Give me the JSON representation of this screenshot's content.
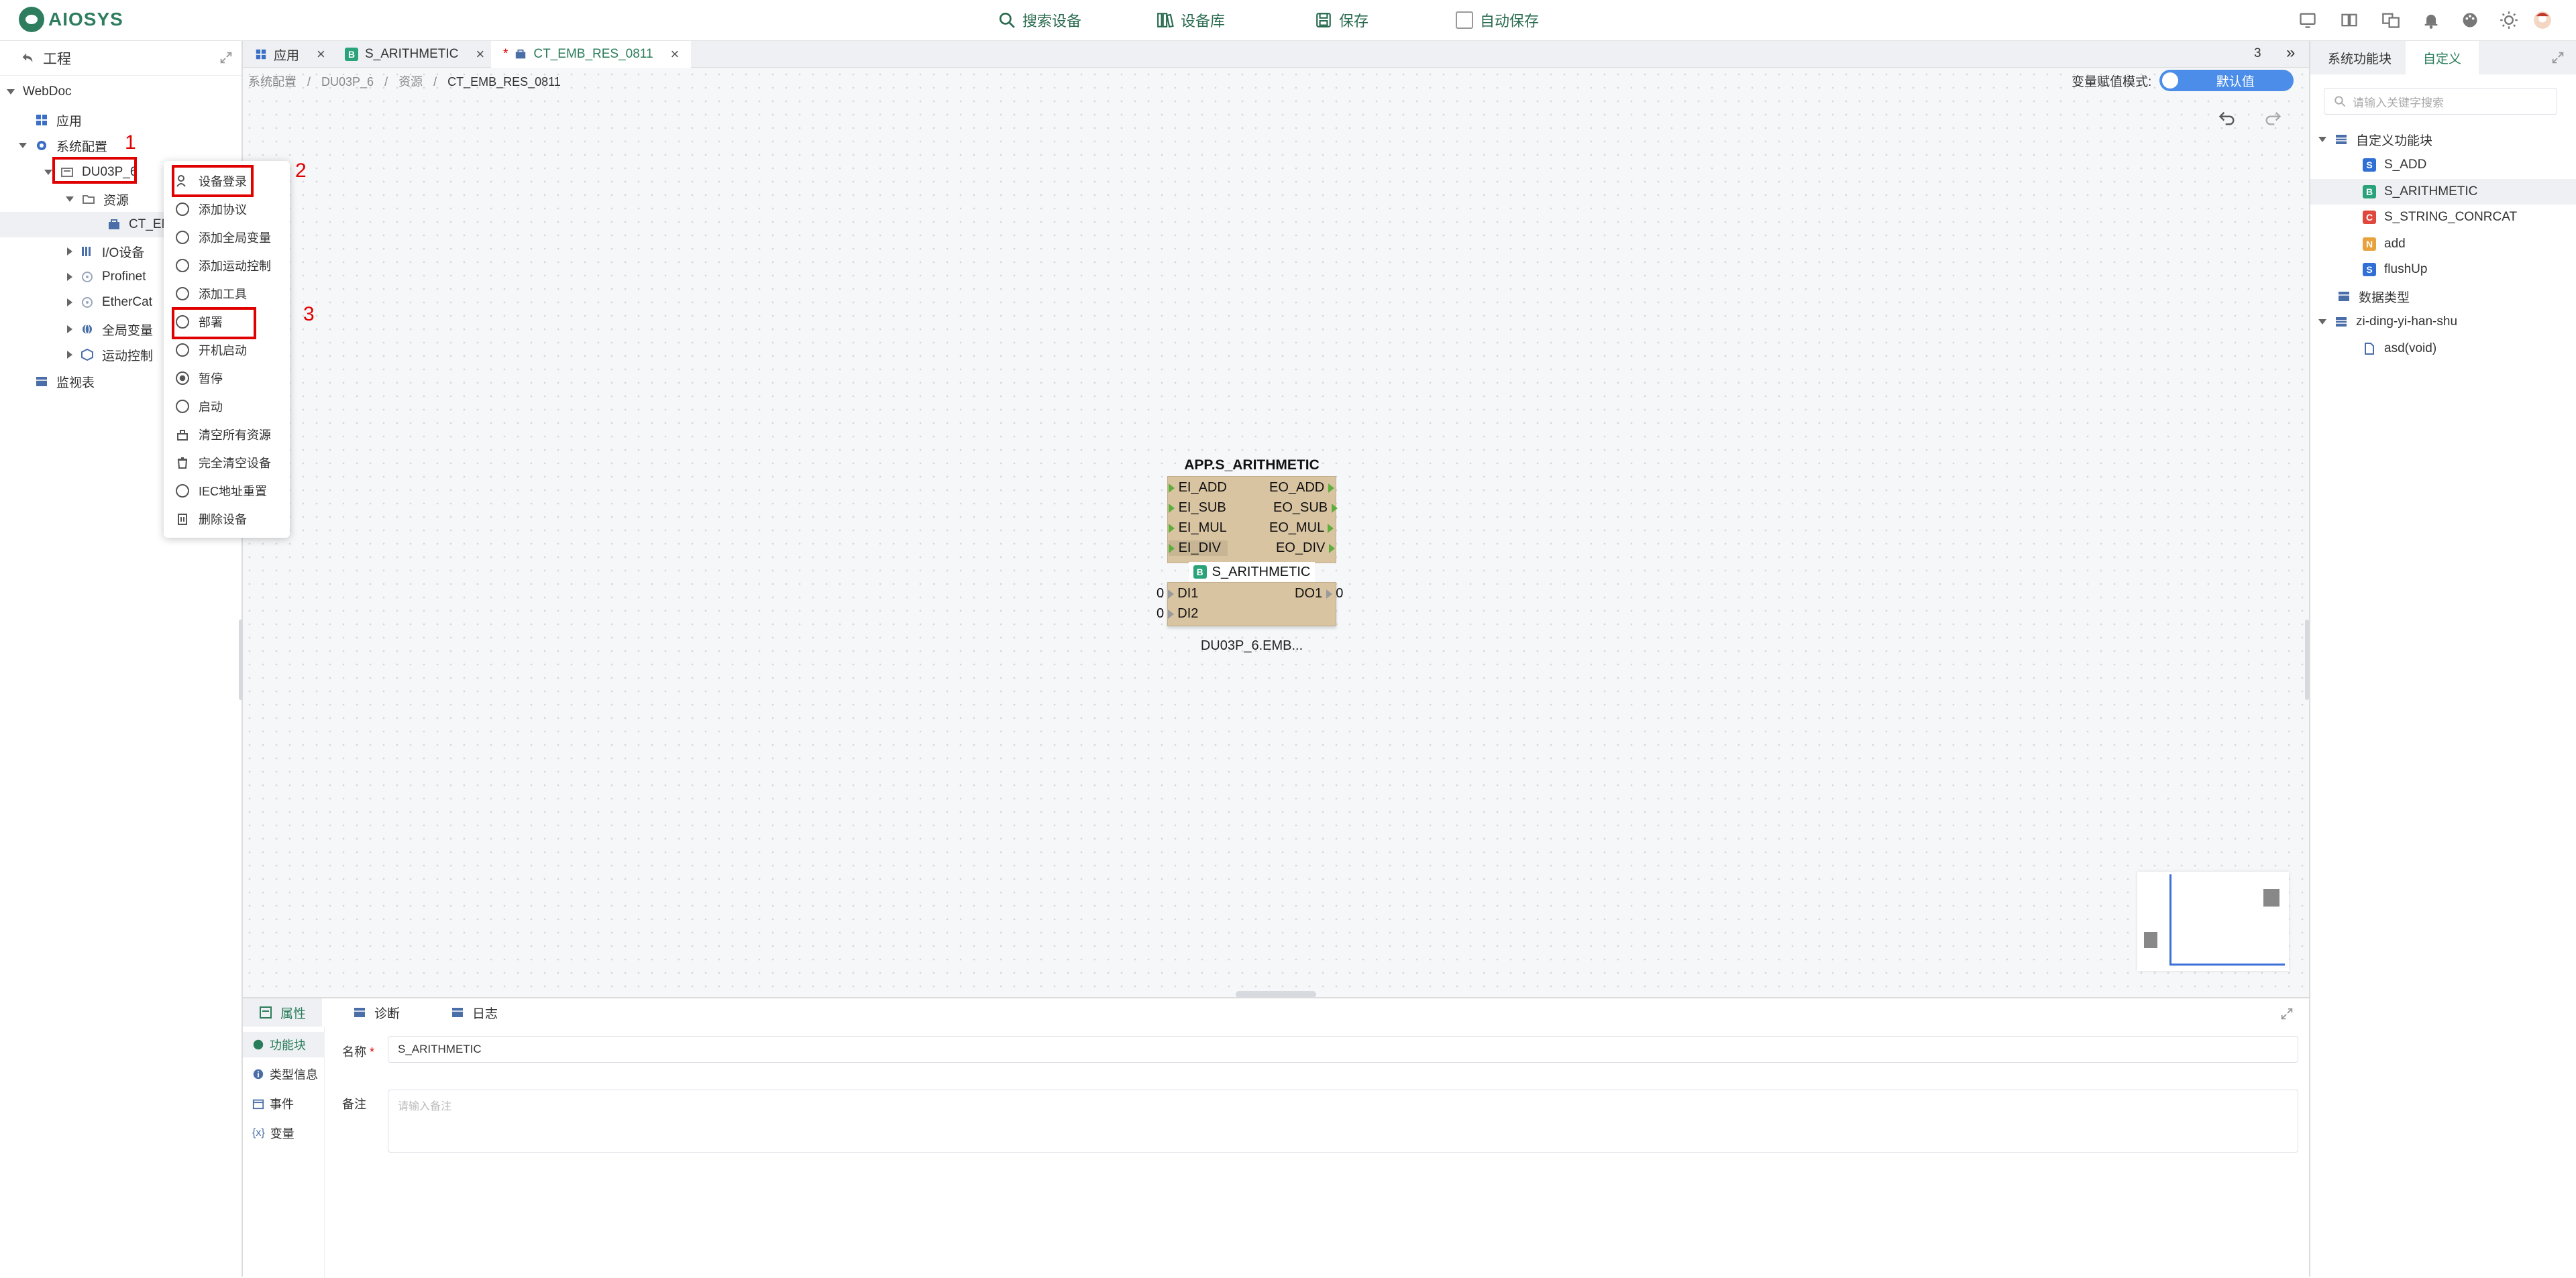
{
  "topbar": {
    "logo_text": "AIOSYS",
    "search_device": "搜索设备",
    "device_library": "设备库",
    "save": "保存",
    "auto_save": "自动保存"
  },
  "left_panel": {
    "title": "工程",
    "tree": {
      "root": "WebDoc",
      "app": "应用",
      "system_config": "系统配置",
      "device": "DU03P_6",
      "resources": "资源",
      "ct": "CT_EM",
      "io": "I/O设备",
      "profinet": "Profinet",
      "ethercat": "EtherCat",
      "global_vars": "全局变量",
      "motion": "运动控制",
      "watch": "监视表"
    }
  },
  "context_menu": {
    "items": [
      "设备登录",
      "添加协议",
      "添加全局变量",
      "添加运动控制",
      "添加工具",
      "部署",
      "开机启动",
      "暂停",
      "启动",
      "清空所有资源",
      "完全清空设备",
      "IEC地址重置",
      "删除设备"
    ]
  },
  "annotations": {
    "n1": "1",
    "n2": "2",
    "n3": "3"
  },
  "tabs": {
    "app": "应用",
    "s_arith": "S_ARITHMETIC",
    "ct_emb": "CT_EMB_RES_0811",
    "modified_mark": "*",
    "count": "3",
    "more": "»"
  },
  "breadcrumb": {
    "l1": "系统配置",
    "l2": "DU03P_6",
    "l3": "资源",
    "l4": "CT_EMB_RES_0811",
    "sep": "/"
  },
  "canvas": {
    "var_mode_label": "变量赋值模式:",
    "var_mode_value": "默认值",
    "fb_title": "APP.S_ARITHMETIC",
    "fb_type": "S_ARITHMETIC",
    "fb_type_badge": "B",
    "fb_instance": "DU03P_6.EMB...",
    "events_in": [
      "EI_ADD",
      "EI_SUB",
      "EI_MUL",
      "EI_DIV"
    ],
    "events_out": [
      "EO_ADD",
      "EO_SUB",
      "EO_MUL",
      "EO_DIV"
    ],
    "data_in": [
      "DI1",
      "DI2"
    ],
    "data_out": [
      "DO1"
    ],
    "di1_value": "0",
    "di2_value": "0",
    "do1_value": "0"
  },
  "bottom_panel": {
    "tab_props": "属性",
    "tab_diag": "诊断",
    "tab_log": "日志",
    "side_fb": "功能块",
    "side_type": "类型信息",
    "side_event": "事件",
    "side_var": "变量",
    "name_label": "名称",
    "name_required": "*",
    "name_value": "S_ARITHMETIC",
    "remark_label": "备注",
    "remark_placeholder": "请输入备注"
  },
  "right_panel": {
    "tab_sys": "系统功能块",
    "tab_custom": "自定义",
    "search_placeholder": "请输入关键字搜索",
    "custom_group": "自定义功能块",
    "items": [
      {
        "badge": "S",
        "label": "S_ADD",
        "color": "#2f6fd6"
      },
      {
        "badge": "B",
        "label": "S_ARITHMETIC",
        "color": "#2aa27a"
      },
      {
        "badge": "C",
        "label": "S_STRING_CONRCAT",
        "color": "#e0483e"
      },
      {
        "badge": "N",
        "label": "add",
        "color": "#e9a23b"
      },
      {
        "badge": "S",
        "label": "flushUp",
        "color": "#2f6fd6"
      }
    ],
    "data_types": "数据类型",
    "zi_group": "zi-ding-yi-han-shu",
    "asd": "asd(void)"
  },
  "colors": {
    "accent": "#2a7d5a",
    "highlight": "#e00000",
    "toggle": "#4b8de8",
    "fb_body": "#d9c4a2"
  }
}
